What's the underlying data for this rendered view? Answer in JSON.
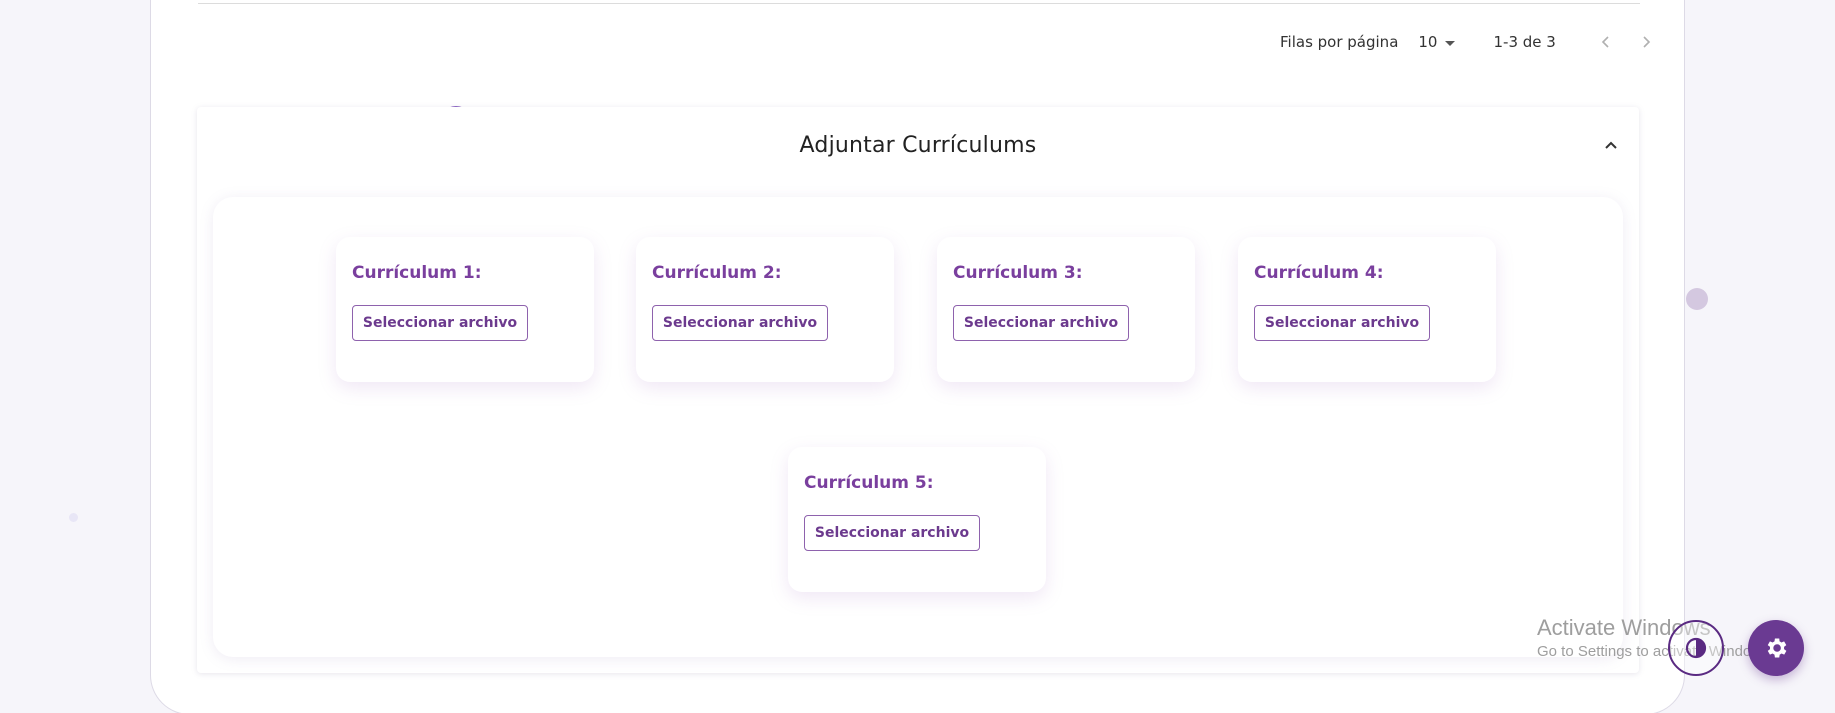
{
  "pagination": {
    "rows_label": "Filas por página",
    "rows_value": "10",
    "range": "1-3 de 3",
    "prev_icon": "chevron-left-icon",
    "next_icon": "chevron-right-icon"
  },
  "accordion": {
    "title": "Adjuntar Currículums",
    "expanded": true,
    "cards": [
      {
        "title": "Currículum 1:",
        "button": "Seleccionar archivo"
      },
      {
        "title": "Currículum 2:",
        "button": "Seleccionar archivo"
      },
      {
        "title": "Currículum 3:",
        "button": "Seleccionar archivo"
      },
      {
        "title": "Currículum 4:",
        "button": "Seleccionar archivo"
      },
      {
        "title": "Currículum 5:",
        "button": "Seleccionar archivo"
      }
    ]
  },
  "watermark": {
    "line1": "Activate Windows",
    "line2": "Go to Settings to activate Windows."
  },
  "fab": {
    "theme_icon": "theme-toggle-icon",
    "settings_icon": "gear-icon"
  },
  "colors": {
    "accent": "#7a3f9e",
    "fab": "#6a3a92"
  }
}
